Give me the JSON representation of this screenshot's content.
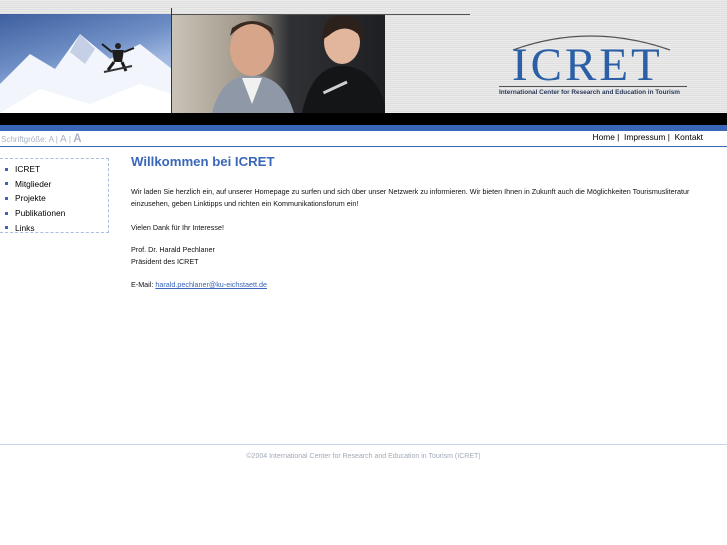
{
  "header": {
    "logo_text": "ICRET",
    "logo_subtitle": "International Center for Research and Education in Tourism"
  },
  "toolbar": {
    "font_size_label": "Schriftgröße:",
    "font_size_options": [
      "A",
      "A",
      "A"
    ],
    "nav": [
      "Home",
      "Impressum",
      "Kontakt"
    ]
  },
  "sidebar": {
    "items": [
      "ICRET",
      "Mitglieder",
      "Projekte",
      "Publikationen",
      "Links"
    ]
  },
  "main": {
    "title": "Willkommen bei ICRET",
    "intro": "Wir laden Sie herzlich ein, auf unserer Homepage zu surfen und sich über unser Netzwerk zu informieren. Wir bieten Ihnen in Zukunft auch die Möglichkeiten Tourismusliteratur einzusehen, geben Linktipps und richten ein Kommunikationsforum ein!",
    "thanks": "Vielen Dank für Ihr Interesse!",
    "signature_name": "Prof. Dr. Harald Pechlaner",
    "signature_role": "Präsident des ICRET",
    "email_label": "E-Mail:",
    "email": "harald.pechlaner@ku-eichstaett.de"
  },
  "footer": {
    "copyright": "©2004 International Center for Research and Education in Tourism (ICRET)"
  },
  "colors": {
    "accent": "#3a66b9",
    "logo": "#2b5fa6"
  }
}
